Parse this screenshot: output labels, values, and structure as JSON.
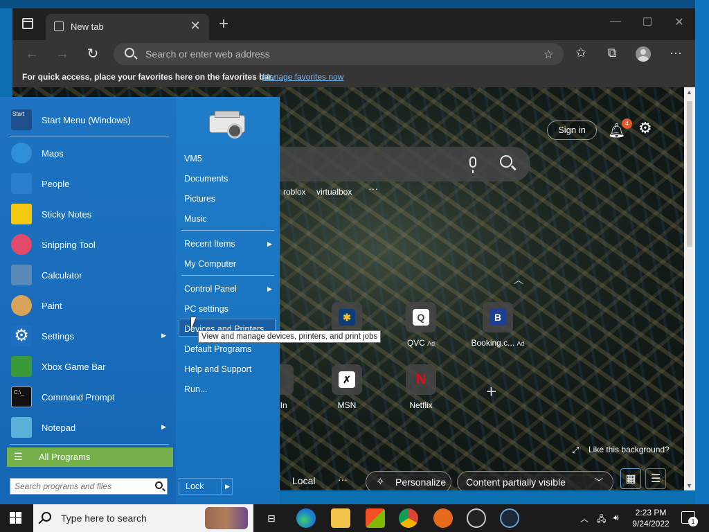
{
  "browser": {
    "tab_title": "New tab",
    "omnibox_placeholder": "Search or enter web address",
    "favbar_text": "For quick access, place your favorites here on the favorites bar.",
    "favbar_link": "Manage favorites now"
  },
  "ntp": {
    "sign_in": "Sign in",
    "notification_count": "4",
    "quick_searches": [
      "roblox",
      "virtualbox"
    ],
    "more": "···",
    "tiles": [
      {
        "label": "",
        "icon_text": ""
      },
      {
        "label": "",
        "icon_text": "✱"
      },
      {
        "label": "QVC",
        "ad": "Ad",
        "icon_text": "Q"
      },
      {
        "label": "Booking.c...",
        "ad": "Ad",
        "icon_text": "B"
      },
      {
        "label": "dIn",
        "icon_text": ""
      },
      {
        "label": "MSN",
        "icon_text": "✗"
      },
      {
        "label": "Netflix",
        "icon_text": "N"
      }
    ],
    "like_background": "Like this background?",
    "local": "Local",
    "personalize": "Personalize",
    "content_visibility": "Content partially visible"
  },
  "start_menu": {
    "header": "Start Menu (Windows)",
    "header_icon_text": "Start",
    "apps": [
      {
        "label": "Maps",
        "color": "#2f8fd6"
      },
      {
        "label": "People",
        "color": "#2a7fd0"
      },
      {
        "label": "Sticky Notes",
        "color": "#f2c811"
      },
      {
        "label": "Snipping Tool",
        "color": "#e24a6a"
      },
      {
        "label": "Calculator",
        "color": "#5a8ab8"
      },
      {
        "label": "Paint",
        "color": "#d9a35a"
      },
      {
        "label": "Settings",
        "color": "#1e6fc0"
      },
      {
        "label": "Xbox Game Bar",
        "color": "#3a9a3a"
      },
      {
        "label": "Command Prompt",
        "color": "#111111"
      },
      {
        "label": "Notepad",
        "color": "#5ab0d8"
      }
    ],
    "all_programs": "All Programs",
    "search_placeholder": "Search programs and files",
    "right_items": [
      "VM5",
      "Documents",
      "Pictures",
      "Music"
    ],
    "right_items_2": [
      "Recent Items",
      "My Computer"
    ],
    "right_items_3": [
      "Control Panel",
      "PC settings",
      "Devices and Printers",
      "Default Programs",
      "Help and Support",
      "Run..."
    ],
    "lock": "Lock",
    "tooltip": "View and manage devices, printers, and print jobs"
  },
  "taskbar": {
    "search_placeholder": "Type here to search",
    "time": "2:23 PM",
    "date": "9/24/2022",
    "notification_count": "1"
  }
}
